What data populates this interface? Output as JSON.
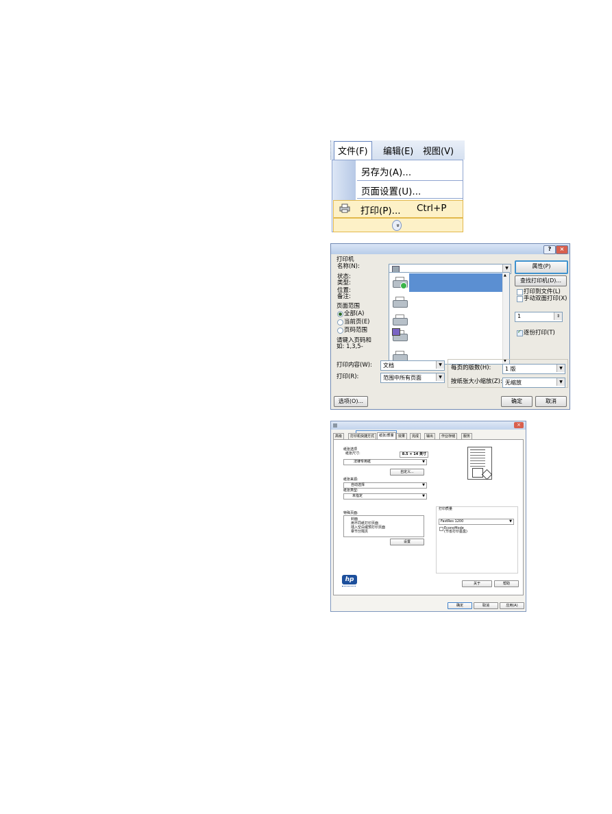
{
  "menu": {
    "bar": [
      "文件(F)",
      "编辑(E)",
      "视图(V)"
    ],
    "items": [
      "另存为(A)...",
      "页面设置(U)..."
    ],
    "print": {
      "label": "打印(P)...",
      "shortcut": "Ctrl+P"
    },
    "expand_glyph": "»"
  },
  "print_dialog": {
    "title_buttons": [
      "?",
      "×"
    ],
    "printer_group": "打印机",
    "name_label": "名称(N):",
    "status_label": "状态:",
    "type_label": "类型:",
    "location_label": "位置:",
    "comment_label": "备注:",
    "range_group": "页面范围",
    "range_all": "全部(A)",
    "range_current": "当前页(E)",
    "range_pages": "页码范围",
    "range_hint_1": "请键入页码和",
    "range_hint_2": "如: 1,3,5-",
    "content_label": "打印内容(W):",
    "content_value": "文档",
    "print_label": "打印(R):",
    "print_value": "范围中所有页面",
    "properties_button": "属性(P)",
    "find_printer_button": "查找打印机(D)...",
    "print_to_file": "打印到文件(L)",
    "manual_duplex": "手动双面打印(X)",
    "copies_value": "1",
    "collate": "逐份打印(T)",
    "pages_per_sheet_label": "每页的版数(H):",
    "pages_per_sheet_value": "1 版",
    "scale_label": "按纸张大小缩放(Z):",
    "scale_value": "无缩放",
    "options_button": "选项(O)...",
    "ok_button": "确定",
    "cancel_button": "取消"
  },
  "properties_dialog": {
    "tabs": [
      "高级",
      "打印机快捷方式",
      "纸张/质量",
      "效果",
      "完成",
      "输出",
      "作业存储",
      "服务"
    ],
    "paper_options": "纸张选项",
    "paper_size_label": "纸张尺寸:",
    "paper_size_value": "8.5 × 14 英寸",
    "paper_type_sel": "法律专用纸",
    "custom_button": "自定义...",
    "paper_source_label": "纸张来源:",
    "paper_source_value": "自动选择",
    "paper_type_label": "纸张类型:",
    "paper_type_value": "未指定",
    "special_pages_label": "特殊页面:",
    "special_pages": [
      "封面",
      "用不同纸打印页面",
      "插入空白或预打印页面",
      "章节分隔页"
    ],
    "settings_button": "设置",
    "print_quality_label": "打印质量",
    "print_quality_value": "FastRes 1200",
    "economode_1": "EconoMode",
    "economode_2": "(节省打印墨盒)",
    "about_button": "关于",
    "help_button": "帮助",
    "ok_button": "确定",
    "cancel_button": "取消",
    "apply_button": "应用(A)"
  }
}
